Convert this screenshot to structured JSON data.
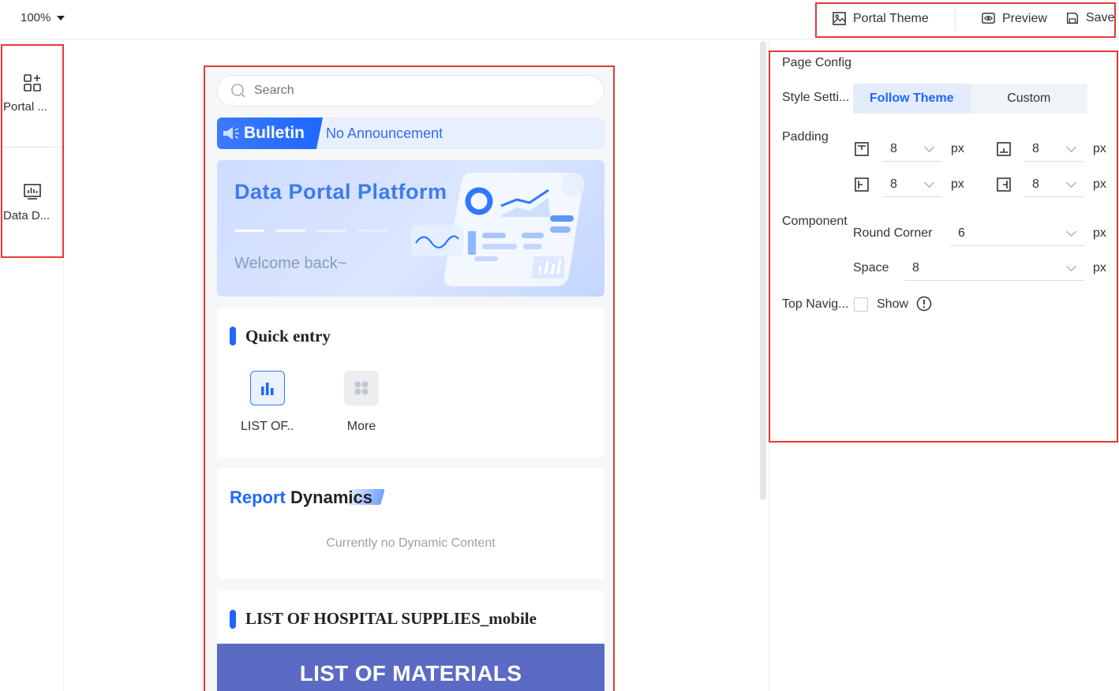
{
  "toolbar": {
    "zoom": "100%",
    "portal_theme": "Portal Theme",
    "preview": "Preview",
    "save": "Save"
  },
  "sidebar": {
    "items": [
      {
        "label": "Portal ...",
        "icon": "apps-add-icon"
      },
      {
        "label": "Data D...",
        "icon": "chart-board-icon"
      }
    ]
  },
  "mobile": {
    "search_placeholder": "Search",
    "bulletin_tag": "Bulletin",
    "bulletin_text": "No Announcement",
    "banner_title": "Data Portal Platform",
    "banner_welcome": "Welcome back~",
    "quick_entry_title": "Quick entry",
    "quick_entry_items": [
      {
        "label": "LIST OF..",
        "icon": "bar-chart-icon"
      },
      {
        "label": "More",
        "icon": "grid-icon"
      }
    ],
    "report_title_part1": "Report",
    "report_title_part2": "Dynamics",
    "report_empty": "Currently no Dynamic Content",
    "list_title": "LIST OF HOSPITAL SUPPLIES_mobile",
    "materials_banner": "LIST OF MATERIALS"
  },
  "panel": {
    "page_config": "Page Config",
    "style_settings": "Style Setti...",
    "style_options": [
      "Follow Theme",
      "Custom"
    ],
    "style_selected": "Follow Theme",
    "padding_label": "Padding",
    "padding": {
      "top": "8",
      "bottom": "8",
      "left": "8",
      "right": "8"
    },
    "unit": "px",
    "component_label": "Component",
    "round_corner_label": "Round Corner",
    "round_corner": "6",
    "space_label": "Space",
    "space": "8",
    "top_nav_label": "Top Navig...",
    "top_nav_show": "Show"
  },
  "colors": {
    "accent": "#1e66ff",
    "highlight": "#e53935",
    "materials": "#5b6bc4"
  }
}
